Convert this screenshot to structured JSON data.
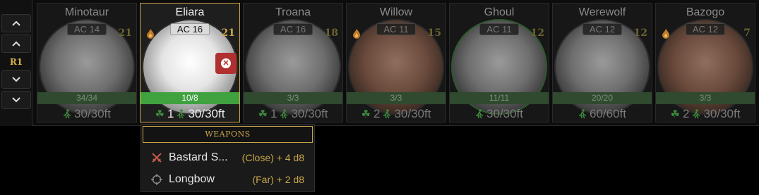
{
  "round": {
    "label": "R1"
  },
  "controls": [
    "move-top",
    "move-up",
    "move-down",
    "move-bottom"
  ],
  "combatants": [
    {
      "name": "Minotaur",
      "ac": "AC 14",
      "initiative": "21",
      "hp": "34/34",
      "lucky": "",
      "speed": "30/30ft",
      "active": false,
      "flame": false,
      "tint": ""
    },
    {
      "name": "Eliara",
      "ac": "AC 16",
      "initiative": "21",
      "hp": "10/8",
      "lucky": "1",
      "speed": "30/30ft",
      "active": true,
      "flame": true,
      "tint": "bright"
    },
    {
      "name": "Troana",
      "ac": "AC 16",
      "initiative": "18",
      "hp": "3/3",
      "lucky": "1",
      "speed": "30/30ft",
      "active": false,
      "flame": false,
      "tint": ""
    },
    {
      "name": "Willow",
      "ac": "AC 11",
      "initiative": "15",
      "hp": "3/3",
      "lucky": "2",
      "speed": "30/30ft",
      "active": false,
      "flame": true,
      "tint": "tint-red"
    },
    {
      "name": "Ghoul",
      "ac": "AC 11",
      "initiative": "12",
      "hp": "11/11",
      "lucky": "",
      "speed": "30/30ft",
      "active": false,
      "flame": false,
      "tint": "tint-green"
    },
    {
      "name": "Werewolf",
      "ac": "AC 12",
      "initiative": "12",
      "hp": "20/20",
      "lucky": "",
      "speed": "60/60ft",
      "active": false,
      "flame": false,
      "tint": ""
    },
    {
      "name": "Bazogo",
      "ac": "AC 12",
      "initiative": "7",
      "hp": "3/3",
      "lucky": "2",
      "speed": "30/30ft",
      "active": false,
      "flame": true,
      "tint": "tint-red"
    }
  ],
  "weapons_popup": {
    "title": "WEAPONS",
    "items": [
      {
        "name": "Bastard S...",
        "stat": "(Close) + 4 d8",
        "icon": "crossed-swords-icon"
      },
      {
        "name": "Longbow",
        "stat": "(Far) + 2 d8",
        "icon": "crosshair-icon"
      }
    ]
  },
  "colors": {
    "accent": "#c9a64a",
    "hp_active": "#3fa23f",
    "hp_inactive": "#2f4a2f",
    "remove": "#b03030",
    "lucky": "#3d8a3d"
  }
}
